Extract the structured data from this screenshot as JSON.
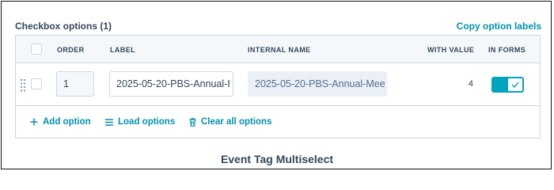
{
  "section": {
    "title": "Checkbox options (1)",
    "copy_link": "Copy option labels"
  },
  "table": {
    "headers": {
      "order": "ORDER",
      "label": "LABEL",
      "internal_name": "INTERNAL NAME",
      "with_value": "WITH VALUE",
      "in_forms": "IN FORMS"
    },
    "rows": [
      {
        "order": "1",
        "label": "2025-05-20-PBS-Annual-I",
        "internal_name": "2025-05-20-PBS-Annual-Mee",
        "with_value": "4",
        "in_forms": true
      }
    ]
  },
  "actions": {
    "add_option": "Add option",
    "load_options": "Load options",
    "clear_all": "Clear all options"
  },
  "caption": "Event Tag Multiselect",
  "colors": {
    "accent": "#0091ae",
    "toggle_on": "#00a4bd",
    "text": "#33475b",
    "border": "#cbd6e2"
  },
  "icons": {
    "add": "plus-icon",
    "load": "list-icon",
    "clear": "trash-icon",
    "drag": "drag-handle-icon",
    "toggle": "check-icon"
  }
}
